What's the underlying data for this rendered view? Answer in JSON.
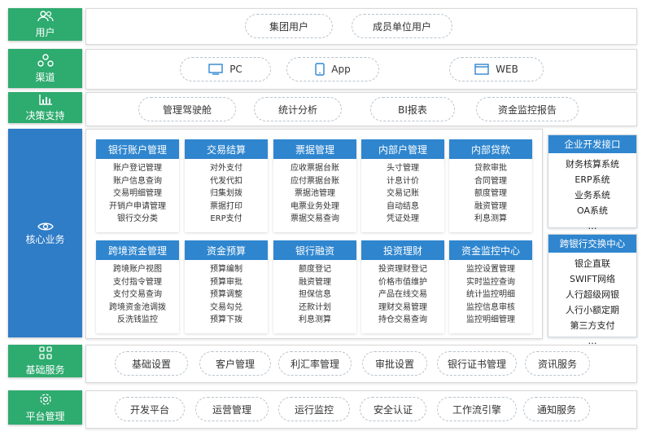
{
  "rows": {
    "users": {
      "label": "用户",
      "icon": "users-icon",
      "items": [
        "集团用户",
        "成员单位用户"
      ]
    },
    "channel": {
      "label": "渠道",
      "icon": "channel-icon",
      "items": [
        {
          "label": "PC",
          "icon": "monitor-icon"
        },
        {
          "label": "App",
          "icon": "mobile-icon"
        },
        {
          "label": "WEB",
          "icon": "browser-icon"
        }
      ]
    },
    "decision": {
      "label": "决策支持",
      "icon": "bar-chart-icon",
      "items": [
        "管理驾驶舱",
        "统计分析",
        "BI报表",
        "资金监控报告"
      ]
    },
    "core": {
      "label": "核心业务",
      "icon": "core-icon"
    },
    "basic": {
      "label": "基础服务",
      "icon": "grid-icon",
      "items": [
        "基础设置",
        "客户管理",
        "利汇率管理",
        "审批设置",
        "银行证书管理",
        "资讯服务"
      ]
    },
    "platform": {
      "label": "平台管理",
      "icon": "settings-icon",
      "items": [
        "开发平台",
        "运营管理",
        "运行监控",
        "安全认证",
        "工作流引擎",
        "通知服务"
      ]
    }
  },
  "core_modules": [
    {
      "title": "银行账户管理",
      "items": [
        "账户登记管理",
        "账户信息查询",
        "交易明细管理",
        "开销户申请管理",
        "银行交分类"
      ]
    },
    {
      "title": "交易结算",
      "items": [
        "对外支付",
        "代发代扣",
        "归集划拨",
        "票据打印",
        "ERP支付"
      ]
    },
    {
      "title": "票据管理",
      "items": [
        "应收票据台账",
        "应付票据台账",
        "票据池管理",
        "电票业务处理",
        "票据交易查询"
      ]
    },
    {
      "title": "内部户管理",
      "items": [
        "头寸管理",
        "计息计价",
        "交易记账",
        "自动结息",
        "凭证处理"
      ]
    },
    {
      "title": "内部贷款",
      "items": [
        "贷款审批",
        "合同管理",
        "额度管理",
        "融资管理",
        "利息测算"
      ]
    },
    {
      "title": "跨境资金管理",
      "items": [
        "跨境账户视图",
        "支付指令管理",
        "支付交易查询",
        "跨境资金池调拨",
        "反洗钱监控"
      ]
    },
    {
      "title": "资金预算",
      "items": [
        "预算编制",
        "预算审批",
        "预算调整",
        "交易勾兑",
        "预算下拨"
      ]
    },
    {
      "title": "银行融资",
      "items": [
        "额度登记",
        "融资管理",
        "担保信息",
        "还款计划",
        "利息测算"
      ]
    },
    {
      "title": "投资理财",
      "items": [
        "投资理财登记",
        "价格市值维护",
        "产品在线交易",
        "理财交易管理",
        "持仓交易查询"
      ]
    },
    {
      "title": "资金监控中心",
      "items": [
        "监控设置管理",
        "实时监控查询",
        "统计监控明细",
        "监控信息审核",
        "监控明细管理"
      ]
    }
  ],
  "side_boxes": [
    {
      "title": "企业开发接口",
      "items": [
        "财务核算系统",
        "ERP系统",
        "业务系统",
        "OA系统",
        "…"
      ]
    },
    {
      "title": "跨银行交换中心",
      "items": [
        "银企直联",
        "SWIFT网络",
        "人行超级网银",
        "人行小额定期",
        "第三方支付",
        "…"
      ]
    }
  ]
}
